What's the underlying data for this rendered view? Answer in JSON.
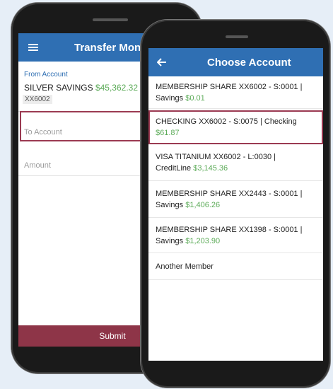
{
  "back_phone": {
    "header": {
      "title": "Transfer Money"
    },
    "from": {
      "label": "From Account",
      "account_name": "SILVER SAVINGS",
      "balance": "$45,362.32",
      "account_number": "XX6002"
    },
    "to_placeholder": "To Account",
    "amount_placeholder": "Amount",
    "submit_label": "Submit"
  },
  "front_phone": {
    "header": {
      "title": "Choose Account"
    },
    "accounts": [
      {
        "line1": "MEMBERSHIP SHARE XX6002 - S:0001 |",
        "prefix": "Savings",
        "balance": "$0.01"
      },
      {
        "line1": "CHECKING XX6002 - S:0075 | Checking",
        "prefix": "",
        "balance": "$61.87"
      },
      {
        "line1": "VISA TITANIUM XX6002 - L:0030 |",
        "prefix": "CreditLine",
        "balance": "$3,145.36"
      },
      {
        "line1": "MEMBERSHIP SHARE XX2443 - S:0001 |",
        "prefix": "Savings",
        "balance": "$1,406.26"
      },
      {
        "line1": "MEMBERSHIP SHARE XX1398 - S:0001 |",
        "prefix": "Savings",
        "balance": "$1,203.90"
      }
    ],
    "another_member": "Another Member"
  },
  "colors": {
    "appbar": "#2f6fb3",
    "balance_green": "#5cab58",
    "highlight": "#9b3a52",
    "submit": "#8e3548"
  }
}
